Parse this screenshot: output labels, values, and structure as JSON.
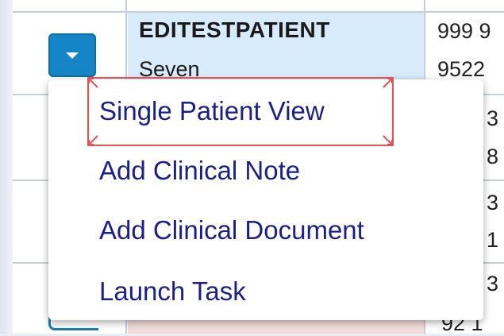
{
  "table": {
    "row1": {
      "patient_surname": "EDITESTPATIENT",
      "patient_firstname": "Seven",
      "number_line1": "999 9",
      "number_line2": "9522"
    },
    "row2": {
      "number_line1": "3",
      "number_line2": "8"
    },
    "row3": {
      "number_line1": "3",
      "number_line2": "1"
    },
    "row4": {
      "number_line1": "3",
      "number_line2": "92 1"
    }
  },
  "menu": {
    "items": [
      {
        "label": "Single Patient View",
        "selected": true
      },
      {
        "label": "Add Clinical Note"
      },
      {
        "label": "Add Clinical Document"
      },
      {
        "label": "Launch Task"
      }
    ]
  },
  "colors": {
    "menu_text": "#1b1f8a",
    "button_blue": "#1585c7",
    "highlight_cell": "#d7ebfb",
    "selection_border": "#e85050"
  },
  "icons": {
    "dropdown_toggle": "caret-down-icon"
  }
}
